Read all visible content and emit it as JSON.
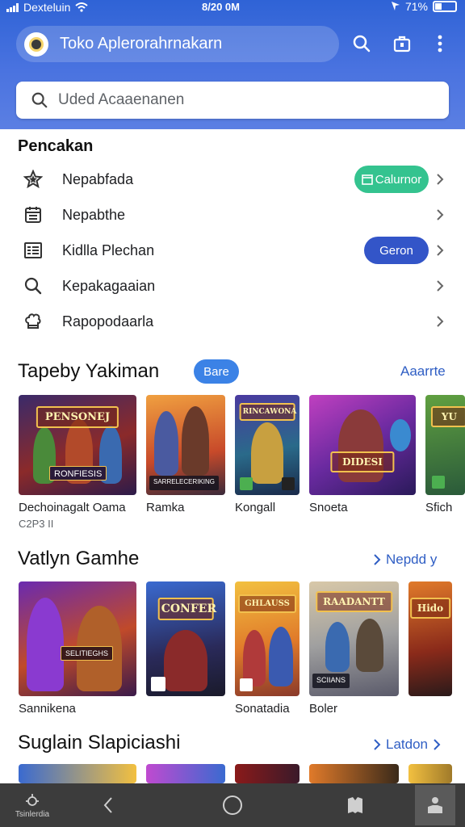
{
  "status": {
    "carrier": "Dexteluin",
    "time": "8/20 0M",
    "battery": "71%"
  },
  "header": {
    "title": "Toko Aplerorahrnakarn",
    "search_placeholder": "Uded Acaaenanen"
  },
  "menu": {
    "title": "Pencakan",
    "items": [
      {
        "label": "Nepabfada",
        "icon": "star-icon",
        "pill": "Calurnor",
        "pill_color": "#34c38f"
      },
      {
        "label": "Nepabthe",
        "icon": "calendar-icon",
        "pill": ""
      },
      {
        "label": "Kidlla Plechan",
        "icon": "list-icon",
        "pill": "Geron",
        "pill_color": "#3355c8"
      },
      {
        "label": "Kepakagaaian",
        "icon": "search-icon",
        "pill": ""
      },
      {
        "label": "Rapopodaarla",
        "icon": "chef-hat-icon",
        "pill": ""
      }
    ]
  },
  "sections": [
    {
      "title": "Tapeby Yakiman",
      "badge": "Bare",
      "link": "Aaarrte",
      "items": [
        {
          "caption": "Dechoinagalt Oama",
          "sub": "C2P3 II",
          "logo": "PENSONEJ",
          "tag": "RONFIESIS"
        },
        {
          "caption": "Ramka",
          "sub": "",
          "logo": "",
          "tag": "SARRELECERIKING"
        },
        {
          "caption": "Kongall",
          "sub": "",
          "logo": "RINCAWONA",
          "tag": ""
        },
        {
          "caption": "Snoeta",
          "sub": "",
          "logo": "DIDESI",
          "tag": ""
        },
        {
          "caption": "Sfich",
          "sub": "",
          "logo": "YU",
          "tag": ""
        }
      ]
    },
    {
      "title": "Vatlyn Gamhe",
      "badge": "",
      "link": "Nepdd y",
      "items": [
        {
          "caption": "Sannikena",
          "logo": "",
          "tag": "SELITIEGHS"
        },
        {
          "caption": "",
          "logo": "CONFER",
          "tag": ""
        },
        {
          "caption": "Sonatadia",
          "logo": "GHLAUSS",
          "tag": ""
        },
        {
          "caption": "Boler",
          "logo": "RAADANTT",
          "tag": "SCIIANS"
        },
        {
          "caption": "",
          "logo": "Hido",
          "tag": ""
        }
      ]
    },
    {
      "title": "Suglain Slapiciashi",
      "link": "Latdon"
    }
  ],
  "navbar": {
    "home_label": "Tsinlerdia"
  }
}
